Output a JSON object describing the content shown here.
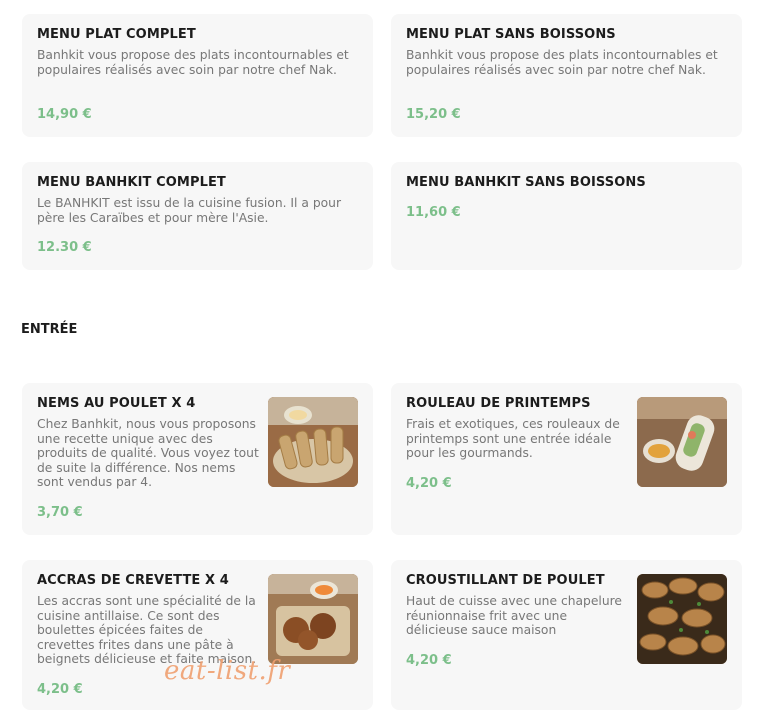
{
  "menus": [
    {
      "title": "MENU PLAT COMPLET",
      "desc": "Banhkit vous propose des plats incontournables et populaires réalisés avec soin par notre chef Nak.",
      "price": "14,90 €"
    },
    {
      "title": "MENU PLAT SANS BOISSONS",
      "desc": "Banhkit vous propose des plats incontournables et populaires réalisés avec soin par notre chef Nak.",
      "price": "15,20 €"
    },
    {
      "title": "MENU BANHKIT COMPLET",
      "desc": "Le BANHKIT est issu de la cuisine fusion. Il a pour père les Caraïbes et pour mère l'Asie.",
      "price": "12.30 €"
    },
    {
      "title": "MENU BANHKIT SANS BOISSONS",
      "desc": "",
      "price": "11,60 €"
    }
  ],
  "section": {
    "title": "ENTRÉE"
  },
  "entrees": [
    {
      "title": "NEMS AU POULET X 4",
      "desc": "Chez Banhkit, nous vous proposons une recette unique avec des produits de qualité. Vous voyez tout de suite la différence. Nos nems sont vendus par 4.",
      "price": "3,70 €",
      "image": "nems-photo"
    },
    {
      "title": "ROULEAU DE PRINTEMPS",
      "desc": "Frais et exotiques, ces rouleaux de printemps sont une entrée idéale pour les gourmands.",
      "price": "4,20 €",
      "image": "spring-roll-photo"
    },
    {
      "title": "ACCRAS DE CREVETTE X 4",
      "desc": "Les accras sont une spécialité de la cuisine antillaise. Ce sont des boulettes épicées faites de crevettes frites dans une pâte à beignets délicieuse et faite maison.",
      "price": "4,20 €",
      "image": "accras-photo"
    },
    {
      "title": "CROUSTILLANT DE POULET",
      "desc": "Haut de cuisse avec une chapelure réunionnaise frit avec une délicieuse sauce maison",
      "price": "4,20 €",
      "image": "fried-chicken-photo"
    }
  ],
  "watermark": "eat-list.fr",
  "colors": {
    "price": "#7cbf8a",
    "card": "#f7f7f7",
    "watermark": "#f0a070"
  }
}
